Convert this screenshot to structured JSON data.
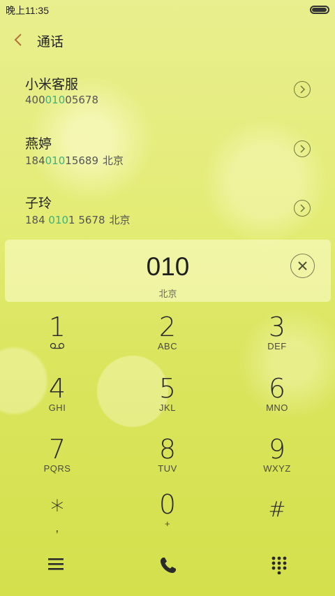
{
  "status_bar": {
    "time": "晚上11:35",
    "battery_level": 0.95
  },
  "header": {
    "back_icon": "chevron-left-icon",
    "title": "通话",
    "accent_color": "#b3723a"
  },
  "contacts": [
    {
      "name": "小米客服",
      "number_prefix": "400",
      "number_match": "010",
      "number_suffix": "05678",
      "location": ""
    },
    {
      "name": "燕婷",
      "number_prefix": "184",
      "number_match": "010",
      "number_suffix": "15689",
      "location": "北京"
    },
    {
      "name": "子玲",
      "number_prefix": "184 ",
      "number_match": "010",
      "number_suffix": "1 5678",
      "location": "北京"
    }
  ],
  "match_color": "#3fb07a",
  "dialer": {
    "number": "010",
    "region": "北京",
    "clear_icon": "clear-x-icon"
  },
  "keypad": [
    {
      "digit": "1",
      "letters": "",
      "icon": "voicemail-icon"
    },
    {
      "digit": "2",
      "letters": "ABC"
    },
    {
      "digit": "3",
      "letters": "DEF"
    },
    {
      "digit": "4",
      "letters": "GHI"
    },
    {
      "digit": "5",
      "letters": "JKL"
    },
    {
      "digit": "6",
      "letters": "MNO"
    },
    {
      "digit": "7",
      "letters": "PQRS"
    },
    {
      "digit": "8",
      "letters": "TUV"
    },
    {
      "digit": "9",
      "letters": "WXYZ"
    },
    {
      "digit": "*",
      "letters": ","
    },
    {
      "digit": "0",
      "letters": "+"
    },
    {
      "digit": "#",
      "letters": ""
    }
  ],
  "bottom_bar": {
    "menu_icon": "menu-icon",
    "call_icon": "phone-call-icon",
    "keypad_icon": "dialpad-icon"
  }
}
